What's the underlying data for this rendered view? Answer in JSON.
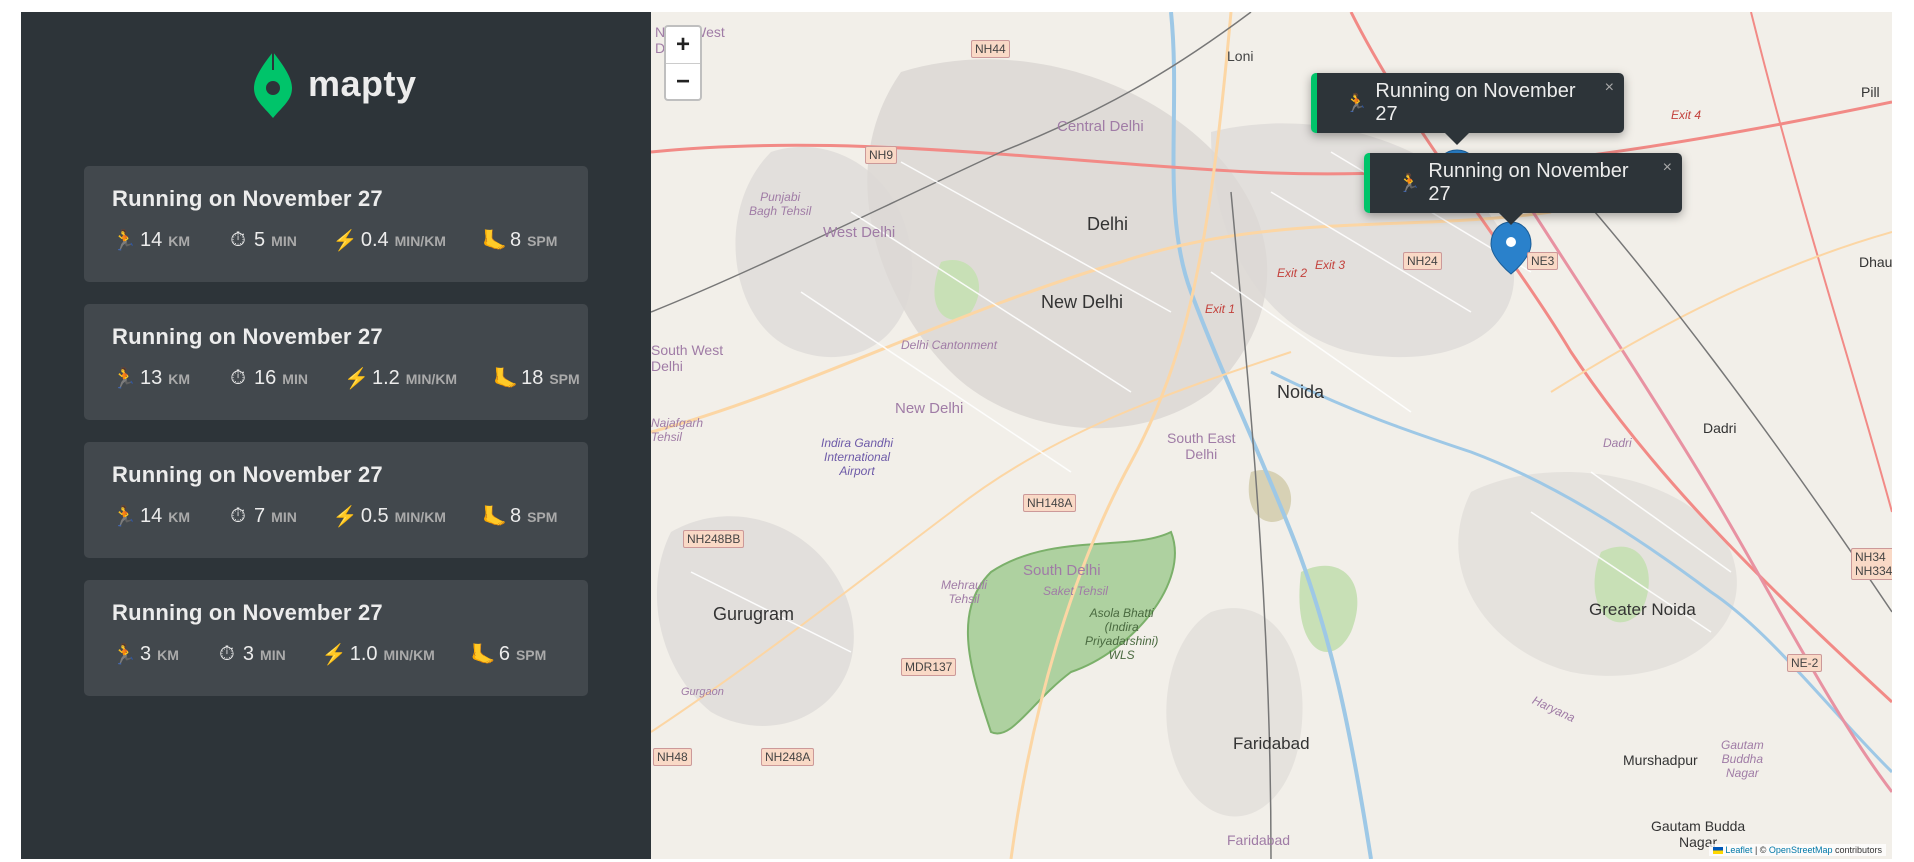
{
  "app": {
    "logo_text": "mapty",
    "brand_color": "#00c46a"
  },
  "workouts": [
    {
      "title": "Running on November 27",
      "distance": "14",
      "duration": "5",
      "pace": "0.4",
      "cadence": "8"
    },
    {
      "title": "Running on November 27",
      "distance": "13",
      "duration": "16",
      "pace": "1.2",
      "cadence": "18"
    },
    {
      "title": "Running on November 27",
      "distance": "14",
      "duration": "7",
      "pace": "0.5",
      "cadence": "8"
    },
    {
      "title": "Running on November 27",
      "distance": "3",
      "duration": "3",
      "pace": "1.0",
      "cadence": "6"
    }
  ],
  "units": {
    "distance": "km",
    "duration": "min",
    "pace": "min/km",
    "cadence": "spm"
  },
  "icons": {
    "running": "🏃",
    "stopwatch": "⏱",
    "lightning": "⚡",
    "foot": "🦶"
  },
  "map": {
    "zoom_in": "+",
    "zoom_out": "−",
    "popups": [
      {
        "title": "Running on November 27",
        "close": "×"
      },
      {
        "title": "Running on November 27",
        "close": "×"
      }
    ],
    "attribution": {
      "leaflet": "Leaflet",
      "sep": " | © ",
      "osm": "OpenStreetMap",
      "tail": " contributors"
    },
    "labels": {
      "north_west_delhi_a": "North West",
      "north_west_delhi_b": "Delhi",
      "loni": "Loni",
      "central_delhi": "Central Delhi",
      "punjabi_bagh_a": "Punjabi",
      "punjabi_bagh_b": "Bagh Tehsil",
      "west_delhi": "West Delhi",
      "delhi": "Delhi",
      "new_delhi": "New Delhi",
      "delhi_cantonment": "Delhi Cantonment",
      "south_west_a": "South West",
      "south_west_b": "Delhi",
      "new_delhi_2": "New Delhi",
      "igi_a": "Indira Gandhi",
      "igi_b": "International",
      "igi_c": "Airport",
      "najafgarh_a": "Najafgarh",
      "najafgarh_b": "Tehsil",
      "noida": "Noida",
      "south_east_a": "South East",
      "south_east_b": "Delhi",
      "south_delhi": "South Delhi",
      "saket": "Saket Tehsil",
      "mehrauli_a": "Mehrauli",
      "mehrauli_b": "Tehsil",
      "asola_a": "Asola Bhatti",
      "asola_b": "(Indira",
      "asola_c": "Priyadarshini)",
      "asola_d": "WLS",
      "gurugram": "Gurugram",
      "gurgaon": "Gurgaon",
      "faridabad": "Faridabad",
      "faridabad_2": "Faridabad",
      "greater_noida": "Greater Noida",
      "dadri": "Dadri",
      "dadri_2": "Dadri",
      "murshadpur": "Murshadpur",
      "gautam_budda_a": "Gautam Budda",
      "gautam_budda_b": "Nagar",
      "gautam_buddha_a": "Gautam",
      "gautam_buddha_b": "Buddha",
      "gautam_buddha_c": "Nagar",
      "haryana": "Haryana",
      "dhau": "Dhau",
      "pill": "Pill",
      "exit2": "Exit 2",
      "exit3": "Exit 3",
      "exit1": "Exit 1",
      "exit4": "Exit 4"
    },
    "shields": {
      "nh44": "NH44",
      "nh9": "NH9",
      "nh24": "NH24",
      "ne3": "NE3",
      "nh148a": "NH148A",
      "nh248bb": "NH248BB",
      "mdr137": "MDR137",
      "nh48": "NH48",
      "nh248a": "NH248A",
      "ne2": "NE-2",
      "nh34a": "NH34",
      "nh34b": "NH334"
    }
  }
}
